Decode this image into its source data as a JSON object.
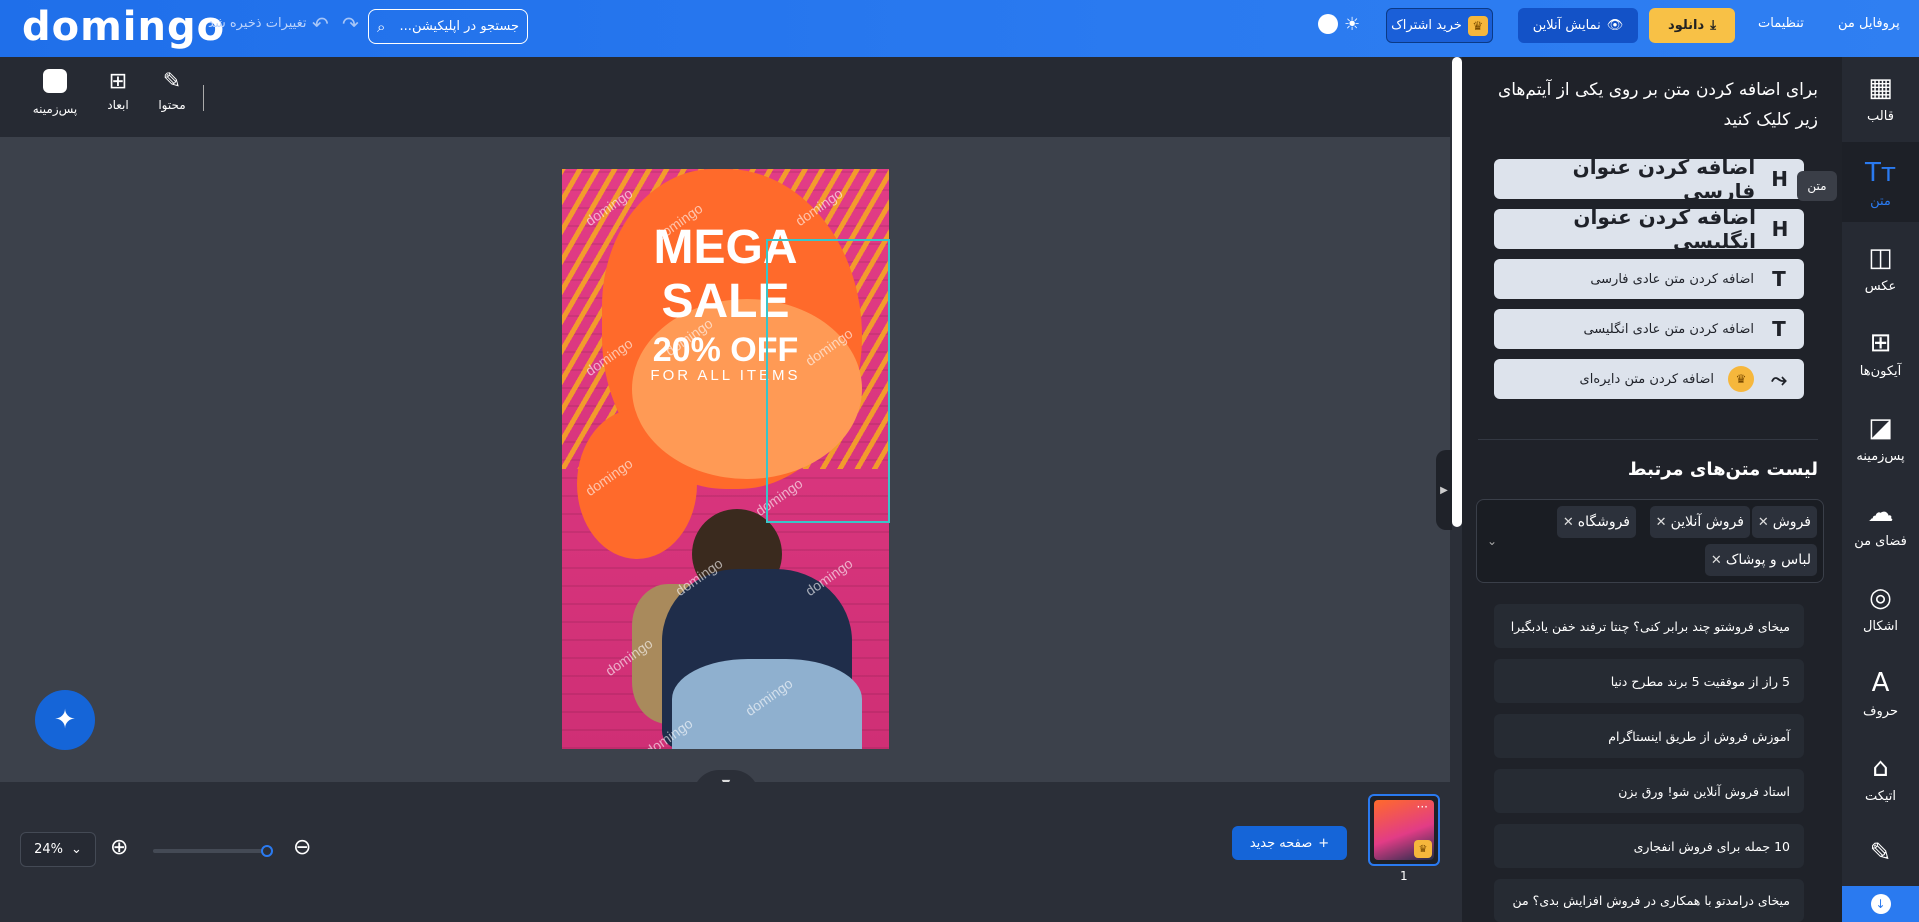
{
  "topbar": {
    "logo": "domingo",
    "saved_status": "تغییرات ذخیره شد",
    "search_placeholder": "جستجو در اپلیکیشن...",
    "subscribe_label": "خرید اشتراک",
    "preview_label": "نمایش آنلاین",
    "download_label": "دانلود",
    "settings_label": "تنظیمات",
    "profile_label": "پروفایل من"
  },
  "toolbar": {
    "background_label": "پس‌زمینه",
    "dimensions_label": "ابعاد",
    "content_label": "محتوا"
  },
  "poster": {
    "line1": "MEGA",
    "line2": "SALE",
    "discount": "20% OFF",
    "subline": "FOR ALL ITEMS",
    "watermark": "domingo"
  },
  "bottom": {
    "zoom_level": "24%",
    "new_page_label": "صفحه جدید",
    "page_number": "1",
    "thumb_menu": "···"
  },
  "panel": {
    "instruction": "برای اضافه کردن متن بر روی یکی از آیتم‌های زیر کلیک کنید",
    "add_buttons": [
      {
        "icon": "H",
        "label": "اضافه کردن عنوان فارسی"
      },
      {
        "icon": "H",
        "label": "اضافه کردن عنوان انگلیسی"
      },
      {
        "icon": "T",
        "label": "اضافه کردن متن عادی فارسی"
      },
      {
        "icon": "T",
        "label": "اضافه کردن متن عادی انگلیسی"
      },
      {
        "icon": "⤳",
        "label": "اضافه کردن متن دایره‌ای"
      }
    ],
    "tooltip": "متن",
    "list_title": "لیست متن‌های مرتبط",
    "tags": [
      "فروش",
      "فروش آنلاین",
      "فروشگاه",
      "لباس و پوشاک"
    ],
    "texts": [
      "میخای فروشتو چند برابر کنی؟ چنتا ترفند خفن یادبگیرا",
      "5 راز از موفقیت 5 برند مطرح دنیا",
      "آموزش فروش از طریق اینستاگرام",
      "استاد فروش آنلاین شو! ورق بزن",
      "10 جمله برای فروش انفجاری",
      "میخای درامدتو با همکاری در فروش افزایش بدی؟ من"
    ]
  },
  "sidebar": {
    "items": [
      {
        "icon": "template-icon",
        "label": "قالب"
      },
      {
        "icon": "text-icon",
        "label": "متن"
      },
      {
        "icon": "photo-icon",
        "label": "عکس"
      },
      {
        "icon": "icons-icon",
        "label": "آیکون‌ها"
      },
      {
        "icon": "background-icon",
        "label": "پس‌زمینه"
      },
      {
        "icon": "cloud-upload-icon",
        "label": "فضای من"
      },
      {
        "icon": "shapes-icon",
        "label": "اشکال"
      },
      {
        "icon": "letters-icon",
        "label": "حروف"
      },
      {
        "icon": "tag-icon",
        "label": "اتیکت"
      },
      {
        "icon": "pen-icon",
        "label": ""
      }
    ],
    "active": "متن"
  },
  "colors": {
    "topbar": "#2a7af0",
    "accent": "#1565d8",
    "download": "#f8c146",
    "selection": "#39c5c9"
  }
}
